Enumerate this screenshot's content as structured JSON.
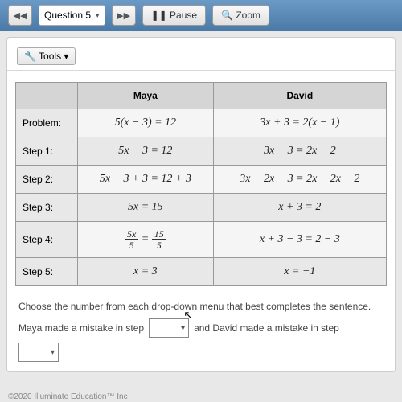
{
  "toolbar": {
    "back": "◀◀",
    "question": "Question 5",
    "fwd": "▶▶",
    "pause": "❚❚ Pause",
    "zoom": "🔍 Zoom",
    "tools": "🔧 Tools ▾"
  },
  "table": {
    "head_blank": "",
    "head_maya": "Maya",
    "head_david": "David",
    "rows": {
      "problem": {
        "label": "Problem:",
        "maya": "5(x − 3) = 12",
        "david": "3x + 3 = 2(x − 1)"
      },
      "s1": {
        "label": "Step 1:",
        "maya": "5x − 3 = 12",
        "david": "3x + 3 = 2x − 2"
      },
      "s2": {
        "label": "Step 2:",
        "maya": "5x − 3 + 3 = 12 + 3",
        "david": "3x − 2x + 3 = 2x − 2x − 2"
      },
      "s3": {
        "label": "Step 3:",
        "maya": "5x = 15",
        "david": "x + 3 = 2"
      },
      "s4": {
        "label": "Step 4:",
        "maya_frac_l_n": "5x",
        "maya_frac_l_d": "5",
        "maya_eq": " = ",
        "maya_frac_r_n": "15",
        "maya_frac_r_d": "5",
        "david": "x + 3 − 3 = 2 − 3"
      },
      "s5": {
        "label": "Step 5:",
        "maya": "x = 3",
        "david": "x = −1"
      }
    }
  },
  "sentence": "Choose the number from each drop-down menu that best completes the sentence.",
  "fill": {
    "p1": "Maya made a mistake in step",
    "p2": "and David made a mistake in step"
  },
  "footer": "©2020  Illuminate Education™ Inc"
}
